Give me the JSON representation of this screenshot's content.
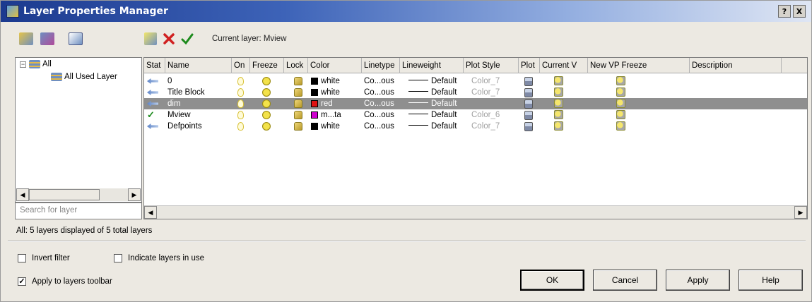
{
  "window": {
    "title": "Layer Properties Manager",
    "help_btn": "?",
    "close_btn": "X"
  },
  "toolbar": {
    "current_layer_label": "Current layer: Mview"
  },
  "tree": {
    "root": "All",
    "child": "All Used Layer",
    "toggle": "−"
  },
  "search": {
    "placeholder": "Search for layer"
  },
  "columns": [
    "Stat",
    "Name",
    "On",
    "Freeze",
    "Lock",
    "Color",
    "Linetype",
    "Lineweight",
    "Plot Style",
    "Plot",
    "Current V",
    "New VP Freeze",
    "Description"
  ],
  "layers": [
    {
      "status": "arrow",
      "name": "0",
      "color_name": "white",
      "color_hex": "#000000",
      "linetype": "Co...ous",
      "lineweight": "Default",
      "plot_style": "Color_7",
      "selected": false
    },
    {
      "status": "arrow",
      "name": "Title Block",
      "color_name": "white",
      "color_hex": "#000000",
      "linetype": "Co...ous",
      "lineweight": "Default",
      "plot_style": "Color_7",
      "selected": false
    },
    {
      "status": "arrow",
      "name": "dim",
      "color_name": "red",
      "color_hex": "#e01010",
      "linetype": "Co...ous",
      "lineweight": "Default",
      "plot_style": "",
      "selected": true
    },
    {
      "status": "check",
      "name": "Mview",
      "color_name": "m...ta",
      "color_hex": "#d000d0",
      "linetype": "Co...ous",
      "lineweight": "Default",
      "plot_style": "Color_6",
      "selected": false
    },
    {
      "status": "arrow",
      "name": "Defpoints",
      "color_name": "white",
      "color_hex": "#000000",
      "linetype": "Co...ous",
      "lineweight": "Default",
      "plot_style": "Color_7",
      "selected": false
    }
  ],
  "status": {
    "summary": "All: 5 layers displayed of 5 total layers"
  },
  "options": {
    "invert_filter": {
      "label": "Invert filter",
      "checked": false
    },
    "indicate_in_use": {
      "label": "Indicate layers in use",
      "checked": false
    },
    "apply_to_toolbar": {
      "label": "Apply to layers toolbar",
      "checked": true
    }
  },
  "buttons": {
    "ok": "OK",
    "cancel": "Cancel",
    "apply": "Apply",
    "help": "Help"
  },
  "icons": {
    "status_current": "check-icon",
    "status_layer": "layer-arrow-icon",
    "on": "lightbulb-icon",
    "freeze": "sun-icon",
    "lock": "padlock-icon",
    "plot": "printer-icon",
    "vp_freeze": "viewport-sun-icon"
  },
  "colors": {
    "titlebar_start": "#1c3a8f",
    "selection": "#8f8f8f",
    "check": "#1c8a1c",
    "delete_x": "#d02020"
  }
}
